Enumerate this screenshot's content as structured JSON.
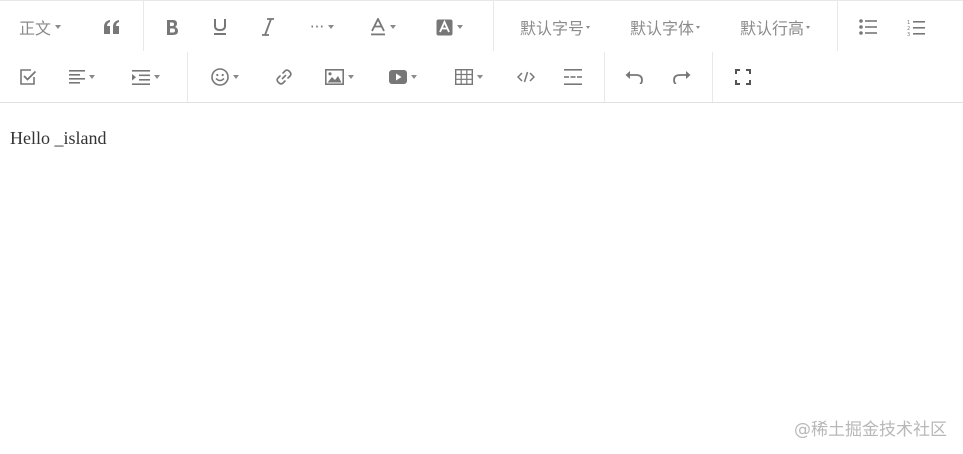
{
  "toolbar": {
    "heading_label": "正文",
    "font_size_label": "默认字号",
    "font_family_label": "默认字体",
    "line_height_label": "默认行高",
    "more_label": "···"
  },
  "icons": {
    "row1": [
      "heading-dropdown",
      "blockquote-icon",
      "bold-icon",
      "underline-icon",
      "italic-icon",
      "more-style-dropdown",
      "font-color-dropdown",
      "background-color-dropdown",
      "font-size-dropdown",
      "font-family-dropdown",
      "line-height-dropdown",
      "bulleted-list-icon",
      "numbered-list-icon"
    ],
    "row2": [
      "todo-icon",
      "justify-dropdown",
      "indent-dropdown",
      "emotion-dropdown",
      "link-icon",
      "image-dropdown",
      "video-dropdown",
      "table-dropdown",
      "code-block-icon",
      "divider-icon",
      "undo-icon",
      "redo-icon",
      "fullscreen-icon"
    ]
  },
  "editor": {
    "content": "Hello _island"
  },
  "watermark": "@稀土掘金技术社区"
}
